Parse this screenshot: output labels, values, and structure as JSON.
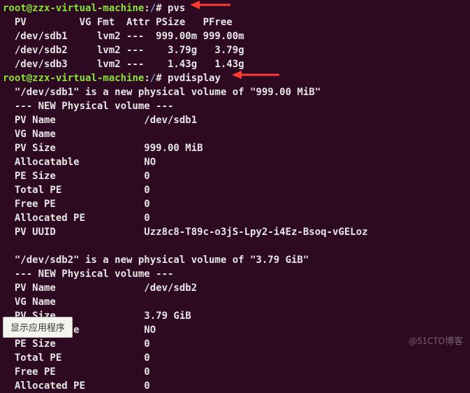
{
  "prompt": {
    "user": "root",
    "at": "@",
    "host": "zzx-virtual-machine",
    "colon": ":",
    "path": "/",
    "hash": "# "
  },
  "cmd1": "pvs",
  "pvs_header": "  PV         VG Fmt  Attr PSize   PFree  ",
  "pvs_rows": [
    "  /dev/sdb1     lvm2 ---  999.00m 999.00m",
    "  /dev/sdb2     lvm2 ---    3.79g   3.79g",
    "  /dev/sdb3     lvm2 ---    1.43g   1.43g"
  ],
  "cmd2": "pvdisplay",
  "pvd1_head": "  \"/dev/sdb1\" is a new physical volume of \"999.00 MiB\"",
  "pvd_sep": "  --- NEW Physical volume ---",
  "pvd1": {
    "name": "  PV Name               /dev/sdb1",
    "vg": "  VG Name               ",
    "size": "  PV Size               999.00 MiB",
    "alloc": "  Allocatable           NO",
    "pe": "  PE Size               0   ",
    "tpe": "  Total PE              0",
    "fpe": "  Free PE               0",
    "ape": "  Allocated PE          0",
    "uuid": "  PV UUID               Uzz8c8-T89c-o3jS-Lpy2-i4Ez-Bsoq-vGELoz"
  },
  "blank": "   ",
  "pvd2_head": "  \"/dev/sdb2\" is a new physical volume of \"3.79 GiB\"",
  "pvd2": {
    "name": "  PV Name               /dev/sdb2",
    "vg": "  VG Name               ",
    "size": "  PV Size               3.79 GiB",
    "alloc": "  Allocatable           NO",
    "pe": "  PE Size               0   ",
    "tpe": "  Total PE              0",
    "fpe": "  Free PE               0",
    "ape": "  Allocated PE          0"
  },
  "tooltip": "显示应用程序",
  "watermark": "@51CTO博客",
  "arrow_color": "#ff3b30"
}
